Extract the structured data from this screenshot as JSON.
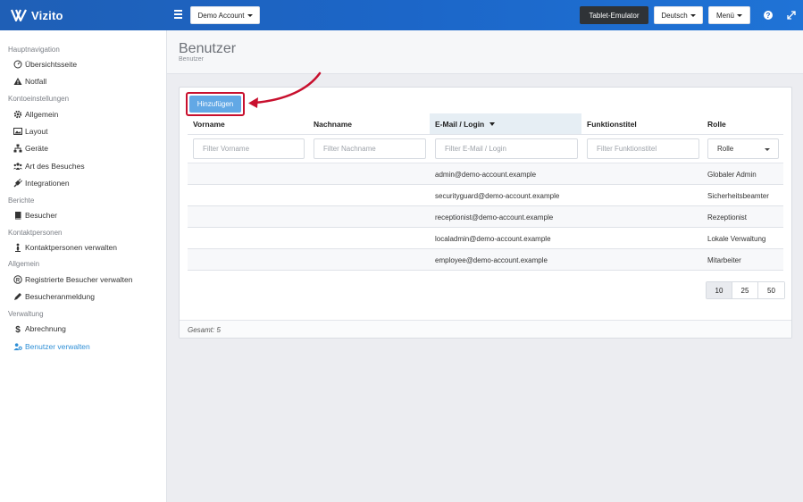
{
  "brand": {
    "name": "Vizito"
  },
  "topbar": {
    "account_label": "Demo Account",
    "tablet_label": "Tablet-Emulator",
    "language_label": "Deutsch",
    "menu_label": "Menü",
    "help_icon": "question-icon",
    "expand_icon": "expand-icon"
  },
  "sidebar": {
    "sections": [
      {
        "label": "Hauptnavigation",
        "items": [
          {
            "label": "Übersichtsseite",
            "icon": "gauge-icon"
          },
          {
            "label": "Notfall",
            "icon": "warning-icon"
          }
        ]
      },
      {
        "label": "Kontoeinstellungen",
        "items": [
          {
            "label": "Allgemein",
            "icon": "gear-icon"
          },
          {
            "label": "Layout",
            "icon": "image-icon"
          },
          {
            "label": "Geräte",
            "icon": "sitemap-icon"
          },
          {
            "label": "Art des Besuches",
            "icon": "users-icon"
          },
          {
            "label": "Integrationen",
            "icon": "plug-icon"
          }
        ]
      },
      {
        "label": "Berichte",
        "items": [
          {
            "label": "Besucher",
            "icon": "book-icon"
          }
        ]
      },
      {
        "label": "Kontaktpersonen",
        "items": [
          {
            "label": "Kontaktpersonen verwalten",
            "icon": "person-icon"
          }
        ]
      },
      {
        "label": "Allgemein",
        "items": [
          {
            "label": "Registrierte Besucher verwalten",
            "icon": "registered-icon"
          },
          {
            "label": "Besucheranmeldung",
            "icon": "pencil-icon"
          }
        ]
      },
      {
        "label": "Verwaltung",
        "items": [
          {
            "label": "Abrechnung",
            "icon": "dollar-icon"
          },
          {
            "label": "Benutzer verwalten",
            "icon": "user-cog-icon",
            "active": true
          }
        ]
      }
    ]
  },
  "page": {
    "title": "Benutzer",
    "breadcrumb": "Benutzer"
  },
  "table": {
    "add_label": "Hinzufügen",
    "columns": [
      "Vorname",
      "Nachname",
      "E-Mail / Login",
      "Funktionstitel",
      "Rolle"
    ],
    "filters": {
      "first_name": "Filter Vorname",
      "last_name": "Filter Nachname",
      "email": "Filter E-Mail / Login",
      "title": "Filter Funktionstitel",
      "role": "Rolle"
    },
    "rows": [
      {
        "email": "admin@demo-account.example",
        "role": "Globaler Admin"
      },
      {
        "email": "securityguard@demo-account.example",
        "role": "Sicherheitsbeamter"
      },
      {
        "email": "receptionist@demo-account.example",
        "role": "Rezeptionist"
      },
      {
        "email": "localadmin@demo-account.example",
        "role": "Lokale Verwaltung"
      },
      {
        "email": "employee@demo-account.example",
        "role": "Mitarbeiter"
      }
    ],
    "page_sizes": [
      "10",
      "25",
      "50"
    ],
    "selected_page_size": "10",
    "total": "Gesamt: 5"
  },
  "colors": {
    "accent": "#2f8fd6",
    "topbar": "#1c66c8",
    "highlight": "#c8102e",
    "add_button": "#62a8e5"
  }
}
